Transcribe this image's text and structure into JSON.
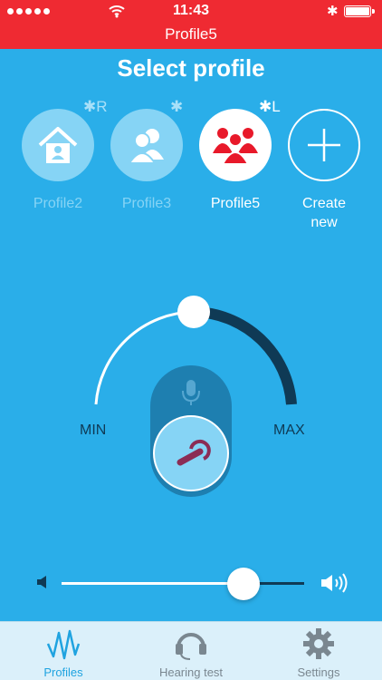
{
  "status_bar": {
    "time": "11:43"
  },
  "nav": {
    "title": "Profile5"
  },
  "main": {
    "title": "Select profile",
    "profiles": [
      {
        "label": "Profile2",
        "tag": "R",
        "state": "inactive",
        "icon": "home-icon"
      },
      {
        "label": "Profile3",
        "tag": "",
        "state": "inactive",
        "icon": "people-icon"
      },
      {
        "label": "Profile5",
        "tag": "L",
        "state": "active",
        "icon": "group-icon"
      },
      {
        "label": "Create new",
        "tag": "",
        "state": "add",
        "icon": "plus-icon"
      }
    ]
  },
  "dial": {
    "min_label": "MIN",
    "max_label": "MAX",
    "level": 0.5
  },
  "volume": {
    "level": 0.75
  },
  "tabbar": {
    "tabs": [
      {
        "label": "Profiles",
        "icon": "waveform-icon",
        "active": true
      },
      {
        "label": "Hearing test",
        "icon": "headset-icon",
        "active": false
      },
      {
        "label": "Settings",
        "icon": "gear-icon",
        "active": false
      }
    ]
  },
  "colors": {
    "status_bar": "#ef2a32",
    "background": "#2aaee9",
    "tab_active": "#1fa3e0",
    "dark_track": "#0f3a55"
  }
}
